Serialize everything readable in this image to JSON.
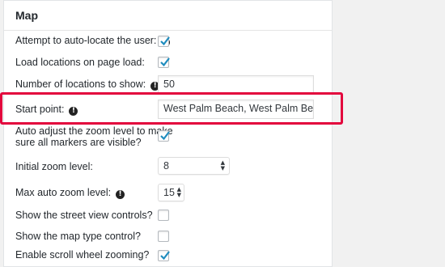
{
  "section": {
    "title": "Map"
  },
  "fields": {
    "auto_locate": {
      "label": "Attempt to auto-locate the user:",
      "checked": true
    },
    "load_on_page_load": {
      "label": "Load locations on page load:",
      "checked": true
    },
    "num_locations": {
      "label": "Number of locations to show:",
      "value": "50"
    },
    "start_point": {
      "label": "Start point:",
      "value": "West Palm Beach, West Palm Beach, F"
    },
    "auto_zoom": {
      "label_line1": "Auto adjust the zoom level to make",
      "label_line2": "sure all markers are visible?",
      "checked": true
    },
    "initial_zoom": {
      "label": "Initial zoom level:",
      "value": "8"
    },
    "max_zoom": {
      "label": "Max auto zoom level:",
      "value": "15"
    },
    "street_view": {
      "label": "Show the street view controls?",
      "checked": false
    },
    "map_type": {
      "label": "Show the map type control?",
      "checked": false
    },
    "scroll_wheel": {
      "label": "Enable scroll wheel zooming?",
      "checked": true
    }
  },
  "icons": {
    "info": "info-icon",
    "check": "checkmark-icon",
    "select_arrows": "updown-arrows-icon"
  },
  "colors": {
    "highlight": "#e3063d",
    "check": "#1e8cbe"
  }
}
